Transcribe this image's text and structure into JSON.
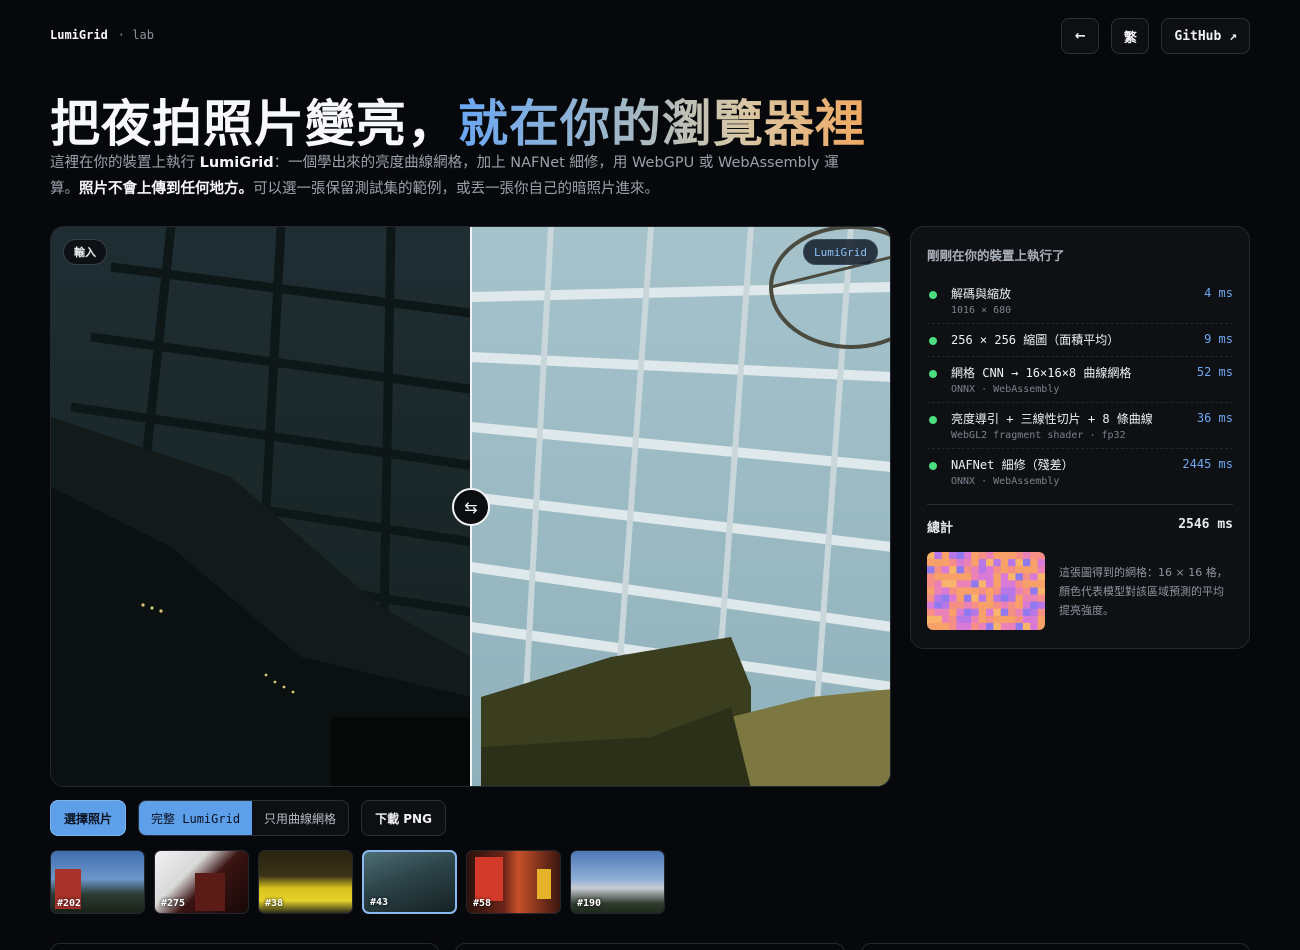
{
  "brand": {
    "name": "LumiGrid",
    "tag": "· lab"
  },
  "top_actions": {
    "back_icon": "←",
    "lang_label": "繁",
    "github_label": "GitHub ↗"
  },
  "hero": {
    "title_plain": "把夜拍照片變亮，",
    "title_gradient": "就在你的瀏覽器裡",
    "desc_1": "這裡在你的裝置上執行 ",
    "desc_brand": "LumiGrid",
    "desc_2": "：一個學出來的亮度曲線網格，加上 NAFNet 細修，用 WebGPU 或 WebAssembly 運算。",
    "desc_bold": "照片不會上傳到任何地方。",
    "desc_3": "可以選一張保留測試集的範例，或丟一張你自己的暗照片進來。"
  },
  "viewer": {
    "input_tag": "輸入",
    "output_tag": "LumiGrid",
    "handle_icon": "⇆",
    "split_fraction": 0.5
  },
  "panel": {
    "title": "剛剛在你的裝置上執行了",
    "steps": [
      {
        "name": "解碼與縮放",
        "sub": "1016 × 680",
        "time": "4 ms"
      },
      {
        "name": "256 × 256 縮圖（面積平均）",
        "sub": "",
        "time": "9 ms"
      },
      {
        "name": "網格 CNN → 16×16×8 曲線網格",
        "sub": "ONNX · WebAssembly",
        "time": "52 ms"
      },
      {
        "name": "亮度導引 + 三線性切片 + 8 條曲線",
        "sub": "WebGL2 fragment shader · fp32",
        "time": "36 ms"
      },
      {
        "name": "NAFNet 細修（殘差）",
        "sub": "ONNX · WebAssembly",
        "time": "2445 ms"
      }
    ],
    "total_label": "總計",
    "total_value": "2546 ms",
    "grid_note": "這張圖得到的網格：16 × 16 格，顏色代表模型對該區域預測的平均提亮強度。"
  },
  "controls": {
    "choose_label": "選擇照片",
    "mode_full": "完整 LumiGrid",
    "mode_curve": "只用曲線網格",
    "download_label": "下載 PNG"
  },
  "thumbs": [
    {
      "label": "#202"
    },
    {
      "label": "#275"
    },
    {
      "label": "#38"
    },
    {
      "label": "#43"
    },
    {
      "label": "#58"
    },
    {
      "label": "#190"
    }
  ]
}
